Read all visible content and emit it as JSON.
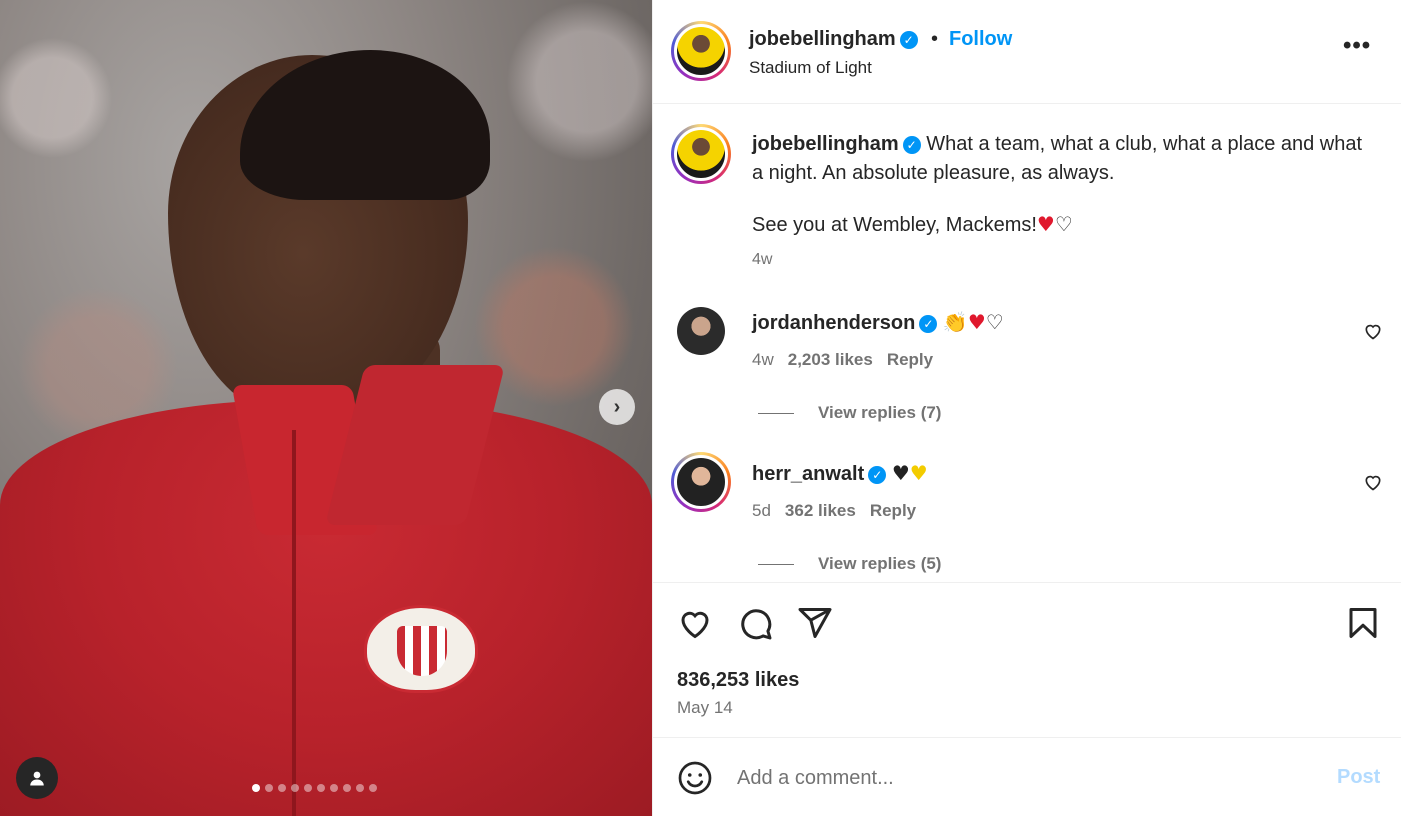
{
  "post": {
    "username": "jobebellingham",
    "follow_label": "Follow",
    "location": "Stadium of Light",
    "caption_line1": "What a team, what a club, what a place and what a night. An absolute pleasure, as always.",
    "caption_line2": "See you at Wembley, Mackems!",
    "caption_time": "4w",
    "likes": "836,253 likes",
    "date": "May 14"
  },
  "comments": [
    {
      "username": "jordanhenderson",
      "time": "4w",
      "likes": "2,203 likes",
      "reply_label": "Reply",
      "view_replies": "View replies (7)"
    },
    {
      "username": "herr_anwalt",
      "time": "5d",
      "likes": "362 likes",
      "reply_label": "Reply",
      "view_replies": "View replies (5)"
    }
  ],
  "composer": {
    "placeholder": "Add a comment...",
    "post_label": "Post"
  },
  "carousel": {
    "slide_count": 10,
    "active_index": 0
  },
  "colors": {
    "accent": "#0095f6",
    "text": "#262626",
    "muted": "#737373",
    "post_disabled": "#b3dbff"
  },
  "icons": {
    "more": "more-options-icon",
    "like": "heart-icon",
    "comment": "comment-icon",
    "share": "share-icon",
    "save": "bookmark-icon",
    "emoji": "emoji-icon",
    "next": "chevron-right-icon",
    "tag": "user-tag-icon"
  }
}
